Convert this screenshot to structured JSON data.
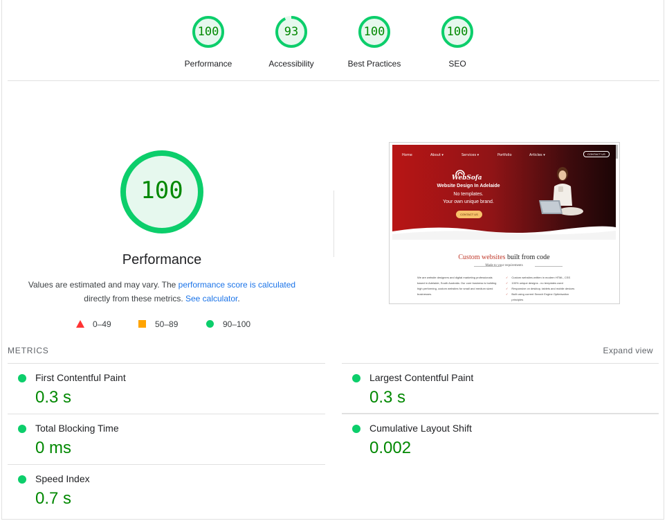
{
  "colors": {
    "pass": "#0cce6b",
    "pass_text": "#008800",
    "average": "#ffa400",
    "fail": "#ff3333",
    "link": "#1a73e8"
  },
  "categories": [
    {
      "label": "Performance",
      "score": 100
    },
    {
      "label": "Accessibility",
      "score": 93
    },
    {
      "label": "Best Practices",
      "score": 100
    },
    {
      "label": "SEO",
      "score": 100
    }
  ],
  "performance": {
    "score": 100,
    "title": "Performance",
    "desc_before": "Values are estimated and may vary. The ",
    "desc_link1": "performance score is calculated",
    "desc_middle": " directly from these metrics. ",
    "desc_link2": "See calculator",
    "desc_after": "."
  },
  "legend": [
    {
      "icon": "triangle-icon",
      "range": "0–49"
    },
    {
      "icon": "square-icon",
      "range": "50–89"
    },
    {
      "icon": "circle-icon",
      "range": "90–100"
    }
  ],
  "screenshot": {
    "nav": [
      "Home",
      "About ▾",
      "Services ▾",
      "Portfolio",
      "Articles ▾"
    ],
    "nav_contact": "CONTACT US",
    "logo": "WebSofa",
    "heading": "Website Design In Adelaide",
    "line1": "No templates.",
    "line2": "Your own unique brand.",
    "button": "CONTACT US",
    "section_title_red": "Custom websites",
    "section_title_rest": " built from code",
    "section_sub": "Made to your requirements",
    "left_text": "We are website designers and digital marketing professionals based in Adelaide, South Australia. Our core business is building high performing, custom websites for small and medium sized businesses.",
    "bullets": [
      "Custom websites written in modern HTML, CSS",
      "100% unique designs - no templates used",
      "Responsive on desktop, tablets and mobile devices",
      "Built using current Search Engine Optimisation",
      "principles"
    ]
  },
  "metrics": {
    "title": "METRICS",
    "expand": "Expand view",
    "items": [
      {
        "label": "First Contentful Paint",
        "value": "0.3 s"
      },
      {
        "label": "Largest Contentful Paint",
        "value": "0.3 s"
      },
      {
        "label": "Total Blocking Time",
        "value": "0 ms"
      },
      {
        "label": "Cumulative Layout Shift",
        "value": "0.002"
      },
      {
        "label": "Speed Index",
        "value": "0.7 s"
      }
    ]
  }
}
